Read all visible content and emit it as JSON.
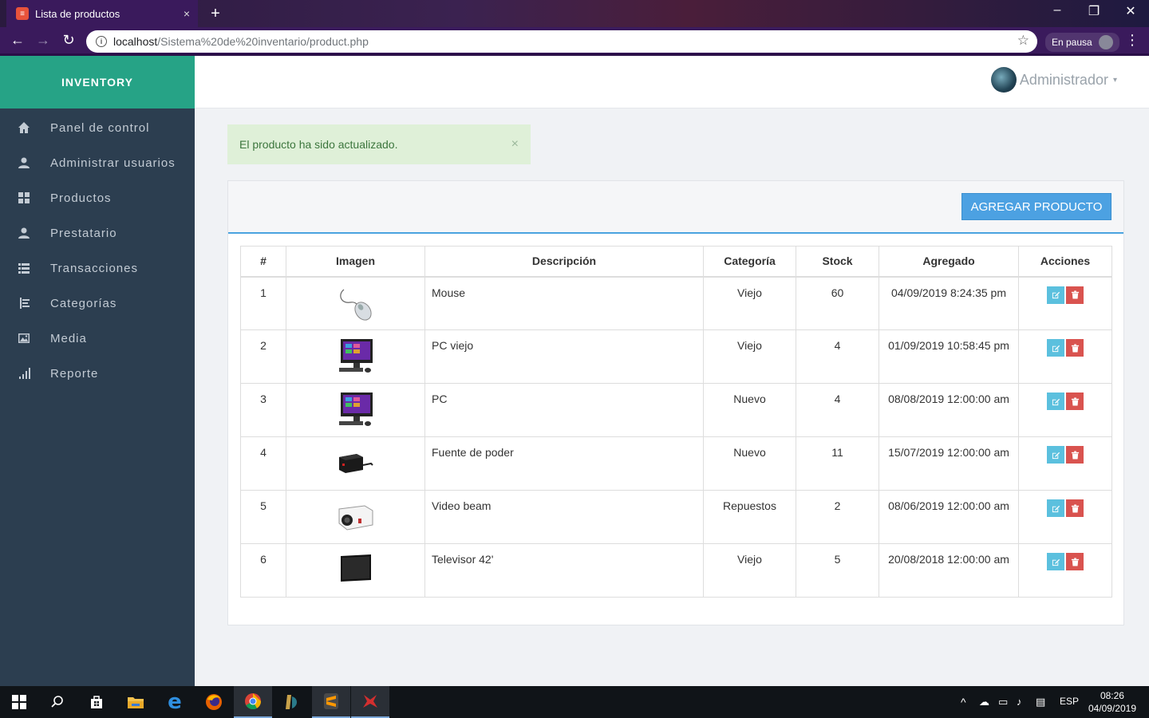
{
  "browser": {
    "tab_title": "Lista de productos",
    "tab_close": "×",
    "new_tab": "+",
    "url_host": "localhost",
    "url_path": "/Sistema%20de%20inventario/product.php",
    "profile_status": "En pausa"
  },
  "sidebar": {
    "brand": "INVENTORY",
    "items": [
      {
        "label": "Panel de control",
        "icon": "home-icon"
      },
      {
        "label": "Administrar usuarios",
        "icon": "user-icon"
      },
      {
        "label": "Productos",
        "icon": "grid-icon"
      },
      {
        "label": "Prestatario",
        "icon": "user-icon"
      },
      {
        "label": "Transacciones",
        "icon": "list-icon"
      },
      {
        "label": "Categorías",
        "icon": "indent-icon"
      },
      {
        "label": "Media",
        "icon": "image-icon"
      },
      {
        "label": "Reporte",
        "icon": "signal-icon"
      }
    ]
  },
  "header": {
    "user_name": "Administrador",
    "caret": "▾"
  },
  "alert": {
    "message": "El producto ha sido actualizado.",
    "close": "×"
  },
  "panel": {
    "add_button": "AGREGAR PRODUCTO"
  },
  "table": {
    "headers": [
      "#",
      "Imagen",
      "Descripción",
      "Categoría",
      "Stock",
      "Agregado",
      "Acciones"
    ],
    "rows": [
      {
        "id": "1",
        "image": "mouse",
        "description": "Mouse",
        "category": "Viejo",
        "stock": "60",
        "added": "04/09/2019 8:24:35 pm"
      },
      {
        "id": "2",
        "image": "pc",
        "description": "PC viejo",
        "category": "Viejo",
        "stock": "4",
        "added": "01/09/2019 10:58:45 pm"
      },
      {
        "id": "3",
        "image": "pc",
        "description": "PC",
        "category": "Nuevo",
        "stock": "4",
        "added": "08/08/2019 12:00:00 am"
      },
      {
        "id": "4",
        "image": "power-supply",
        "description": "Fuente de poder",
        "category": "Nuevo",
        "stock": "11",
        "added": "15/07/2019 12:00:00 am"
      },
      {
        "id": "5",
        "image": "projector",
        "description": "Video beam",
        "category": "Repuestos",
        "stock": "2",
        "added": "08/06/2019 12:00:00 am"
      },
      {
        "id": "6",
        "image": "tv",
        "description": "Televisor 42'",
        "category": "Viejo",
        "stock": "5",
        "added": "20/08/2018 12:00:00 am"
      }
    ]
  },
  "taskbar": {
    "language": "ESP",
    "time": "08:26",
    "date": "04/09/2019"
  },
  "colors": {
    "sidebar_bg": "#2c3e50",
    "brand_bg": "#26a386",
    "accent_blue": "#4ca1e2",
    "alert_bg": "#dff0d8",
    "edit_btn": "#5bc0de",
    "delete_btn": "#d9534f"
  }
}
